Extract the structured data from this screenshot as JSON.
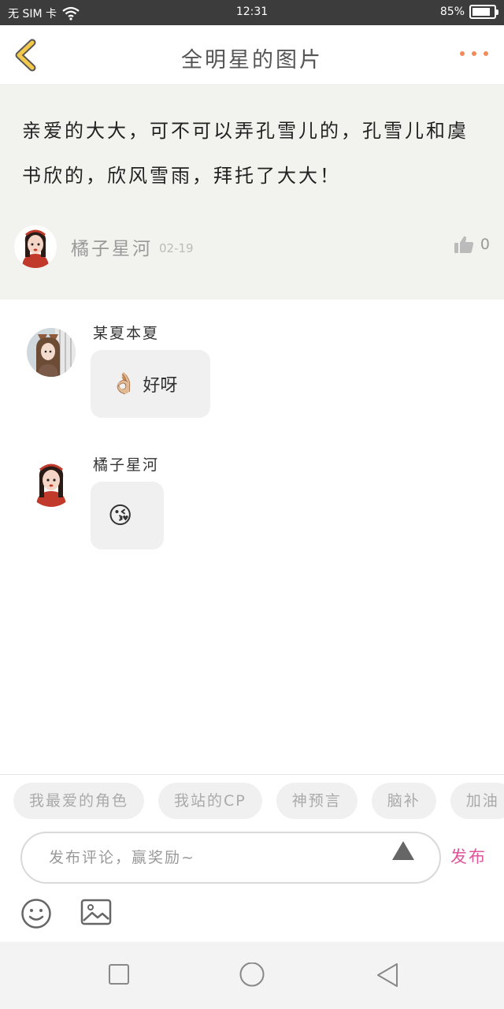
{
  "status_bar": {
    "carrier": "无 SIM 卡",
    "time": "12:31",
    "battery": "85%",
    "battery_level": 0.85
  },
  "header": {
    "title": "全明星的图片"
  },
  "post": {
    "text": "亲爱的大大，可不可以弄孔雪儿的，孔雪儿和虞书欣的，欣风雪雨，拜托了大大！",
    "author": "橘子星河",
    "date": "02-19",
    "likes": "0"
  },
  "comments": [
    {
      "name": "某夏本夏",
      "emoji": "👌🏼",
      "text": "好呀"
    },
    {
      "name": "橘子星河",
      "emoji": "😘",
      "text": ""
    }
  ],
  "composer": {
    "tags": [
      "我最爱的角色",
      "我站的CP",
      "神预言",
      "脑补",
      "加油"
    ],
    "placeholder": "发布评论，赢奖励~",
    "publish_label": "发布"
  },
  "icons": {
    "back": "chevron-left-icon",
    "more": "more-dots-icon",
    "like": "thumbs-up-icon",
    "send": "send-arrow-icon",
    "emoji": "smiley-icon",
    "image": "image-icon"
  },
  "colors": {
    "back_arrow": "#f2c94c",
    "more_dots": "#f08c5a",
    "publish": "#e0559a",
    "post_bg": "#f2f2ee"
  }
}
